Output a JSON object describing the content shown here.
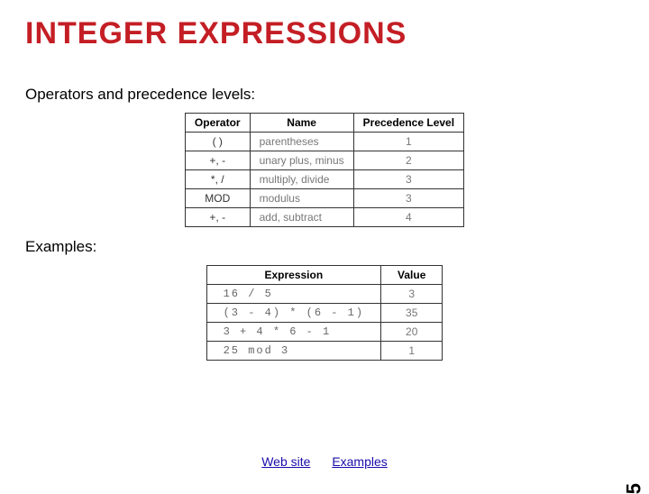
{
  "title": "INTEGER EXPRESSIONS",
  "subhead1": "Operators and precedence levels:",
  "opHeaders": {
    "c1": "Operator",
    "c2": "Name",
    "c3": "Precedence Level"
  },
  "ops": [
    {
      "op": "( )",
      "name": "parentheses",
      "lvl": "1"
    },
    {
      "op": "+, -",
      "name": "unary plus, minus",
      "lvl": "2"
    },
    {
      "op": "*, /",
      "name": "multiply, divide",
      "lvl": "3"
    },
    {
      "op": "MOD",
      "name": "modulus",
      "lvl": "3"
    },
    {
      "op": "+, -",
      "name": "add, subtract",
      "lvl": "4"
    }
  ],
  "subhead2": "Examples:",
  "exHeaders": {
    "c1": "Expression",
    "c2": "Value"
  },
  "exs": [
    {
      "expr": "16 / 5",
      "val": "3"
    },
    {
      "expr": "(3 - 4) * (6 - 1)",
      "val": "35"
    },
    {
      "expr": "3 + 4 * 6 - 1",
      "val": "20"
    },
    {
      "expr": "25 mod 3",
      "val": "1"
    }
  ],
  "links": {
    "website": "Web site",
    "examples": "Examples"
  },
  "pagenum": "5"
}
